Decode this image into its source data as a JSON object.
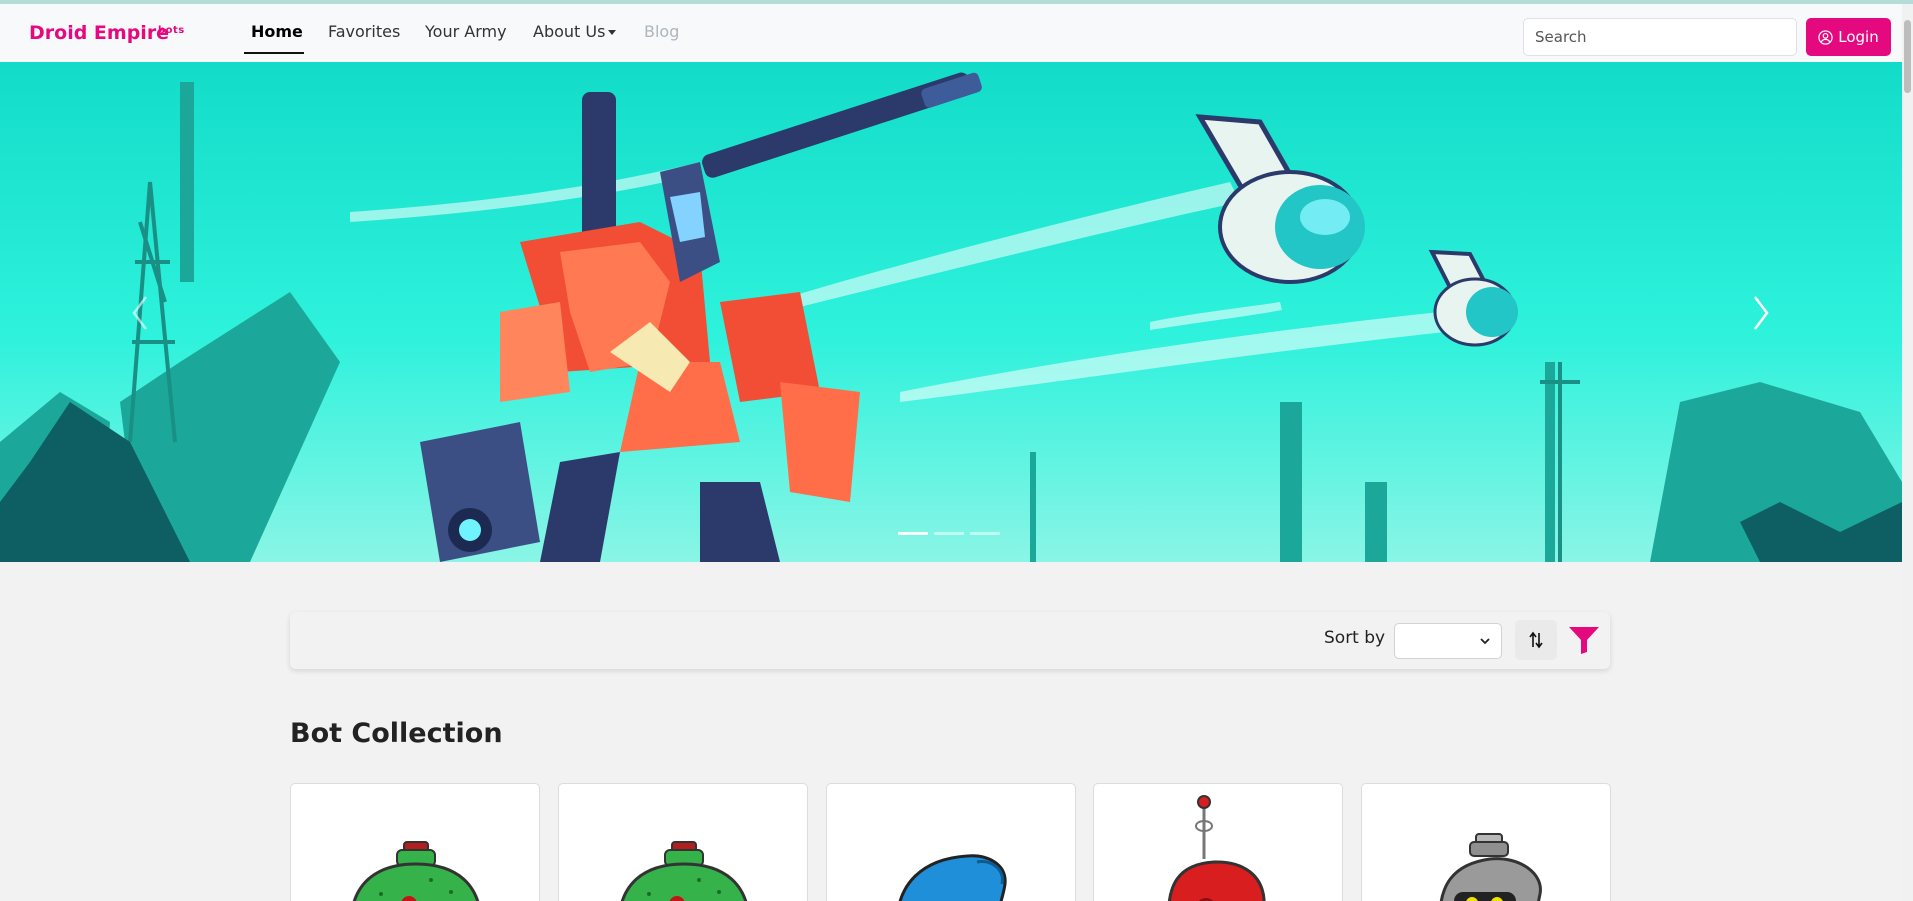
{
  "brand": {
    "name": "Droid Empire",
    "tagline": "bots",
    "color": "#e5097f"
  },
  "nav": {
    "items": [
      {
        "label": "Home",
        "active": true
      },
      {
        "label": "Favorites"
      },
      {
        "label": "Your Army"
      },
      {
        "label": "About Us",
        "dropdown": true
      },
      {
        "label": "Blog",
        "disabled": true
      }
    ]
  },
  "search": {
    "placeholder": "Search"
  },
  "login": {
    "label": "Login",
    "icon": "user-circle-icon"
  },
  "carousel": {
    "slides": 3,
    "active_slide": 1,
    "controls": [
      "chevron-left-icon",
      "chevron-right-icon"
    ]
  },
  "toolbar": {
    "sort_label": "Sort by",
    "sort_value": "",
    "order_icon": "sort-arrows-icon",
    "filter_icon": "filter-icon",
    "filter_color": "#e5097f"
  },
  "collection": {
    "title": "Bot Collection",
    "bots": [
      {
        "name": "green-bot",
        "color": "#35b34a"
      },
      {
        "name": "green-bot",
        "color": "#35b34a"
      },
      {
        "name": "blue-bot",
        "color": "#1f8fd9"
      },
      {
        "name": "red-bot",
        "color": "#d81e1e"
      },
      {
        "name": "gray-bot",
        "color": "#9a9a9a"
      }
    ]
  }
}
